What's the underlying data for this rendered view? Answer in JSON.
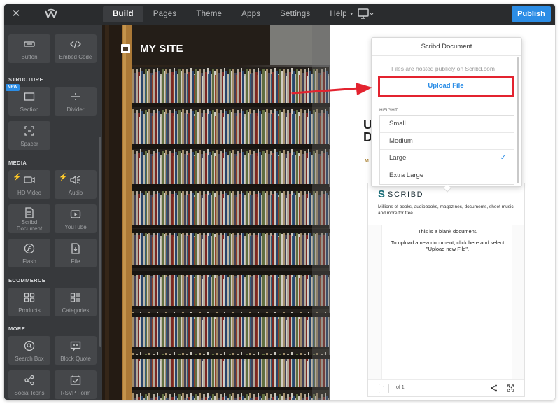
{
  "topbar": {
    "close_icon": "close-icon",
    "logo_icon": "weebly-w-logo",
    "nav": [
      {
        "label": "Build",
        "active": true
      },
      {
        "label": "Pages",
        "active": false
      },
      {
        "label": "Theme",
        "active": false
      },
      {
        "label": "Apps",
        "active": false
      },
      {
        "label": "Settings",
        "active": false
      },
      {
        "label": "Help",
        "active": false,
        "dropdown": true
      }
    ],
    "device_icon": "desktop-monitor-icon",
    "publish_label": "Publish"
  },
  "sidebar": {
    "sections": [
      {
        "heading": "STRUCTURE"
      },
      {
        "heading": "MEDIA"
      },
      {
        "heading": "ECOMMERCE"
      },
      {
        "heading": "MORE"
      }
    ],
    "new_badge": "NEW",
    "tiles": {
      "button": "Button",
      "embed_code": "Embed Code",
      "section": "Section",
      "divider": "Divider",
      "spacer": "Spacer",
      "hd_video": "HD Video",
      "audio": "Audio",
      "scribd_document_line1": "Scribd",
      "scribd_document_line2": "Document",
      "youtube": "YouTube",
      "flash": "Flash",
      "file": "File",
      "products": "Products",
      "categories": "Categories",
      "search_box": "Search Box",
      "block_quote": "Block Quote",
      "social_icons": "Social Icons",
      "rsvp_form": "RSVP Form"
    }
  },
  "hero": {
    "site_name": "MY SITE"
  },
  "page": {
    "partial_char_1": "U",
    "partial_char_2": "D",
    "partial_char_3": "M"
  },
  "popover": {
    "title": "Scribd Document",
    "note": "Files are hosted publicly on Scribd.com",
    "upload_label": "Upload File",
    "height_label": "HEIGHT",
    "height_options": [
      "Small",
      "Medium",
      "Large",
      "Extra Large"
    ],
    "selected_height": "Large"
  },
  "embed": {
    "brand": "SCRIBD",
    "description": "Millions of books, audiobooks, magazines, documents, sheet music, and more for free.",
    "doc_line1": "This is a blank document.",
    "doc_line2": "To upload a new document, click here and select \"Upload new File\".",
    "page_number": "1",
    "page_of": "of 1"
  },
  "colors": {
    "topbar_bg": "#2a2c2e",
    "sidebar_bg": "#37393c",
    "tile_bg": "#45474a",
    "accent_blue": "#2b8de6",
    "annotation_red": "#e3232f",
    "bolt_yellow": "#f2b72a"
  }
}
